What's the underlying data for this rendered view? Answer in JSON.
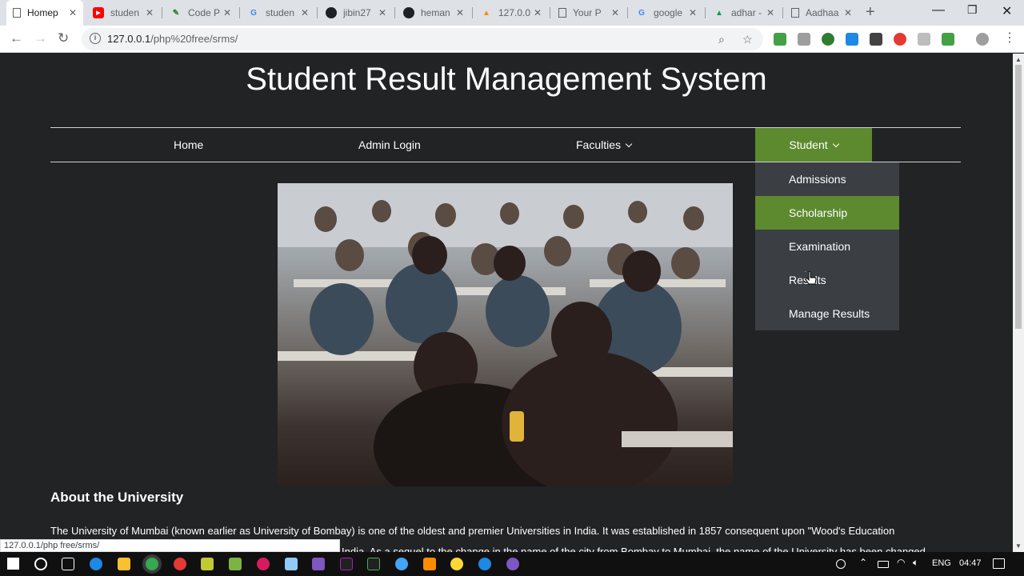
{
  "browser": {
    "tabs": [
      {
        "title": "Homep",
        "active": true
      },
      {
        "title": "studen"
      },
      {
        "title": "Code P"
      },
      {
        "title": "studen"
      },
      {
        "title": "jibin27"
      },
      {
        "title": "heman"
      },
      {
        "title": "127.0.0"
      },
      {
        "title": "Your P"
      },
      {
        "title": "google"
      },
      {
        "title": "adhar -"
      },
      {
        "title": "Aadhaa"
      }
    ],
    "url_host": "127.0.0.1",
    "url_path": "/php%20free/srms/",
    "status_url": "127.0.0.1/php free/srms/"
  },
  "site": {
    "title": "Student Result Management System",
    "nav": {
      "home": "Home",
      "admin_login": "Admin Login",
      "faculties": "Faculties",
      "student": "Student"
    },
    "student_menu": [
      "Admissions",
      "Scholarship",
      "Examination",
      "Results",
      "Manage Results"
    ],
    "about_title": "About the University",
    "about_line1": "The University of Mumbai (known earlier as University of Bombay) is one of the oldest and premier Universities in India. It was established in 1857 consequent upon \"Wood's Education",
    "about_line2": "India. As a sequel to the change in the name of the city from Bombay to Mumbai, the name of the University has been changed"
  },
  "taskbar": {
    "language": "ENG",
    "time": "04:47"
  },
  "colors": {
    "accent": "#5d8a2e",
    "page_bg": "#222325",
    "dropdown_bg": "#3b3e43"
  }
}
